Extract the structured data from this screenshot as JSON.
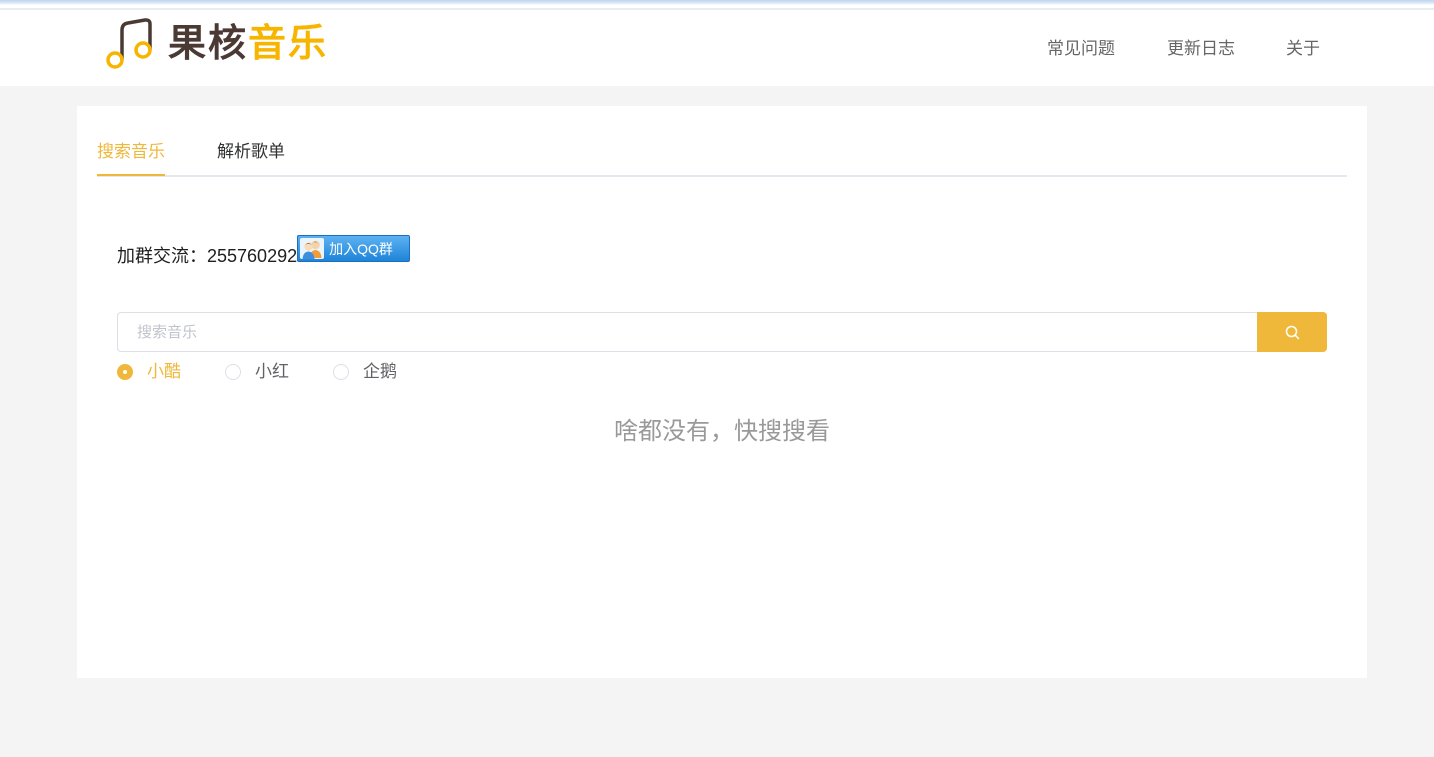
{
  "header": {
    "logo": {
      "text_primary": "果核",
      "text_accent": "音乐",
      "icon": "music-note-icon"
    },
    "nav": [
      {
        "label": "常见问题"
      },
      {
        "label": "更新日志"
      },
      {
        "label": "关于"
      }
    ]
  },
  "tabs": [
    {
      "label": "搜索音乐",
      "active": true
    },
    {
      "label": "解析歌单",
      "active": false
    }
  ],
  "group": {
    "label": "加群交流：",
    "number": "255760292",
    "join_button": {
      "label": "加入QQ群",
      "icon": "qq-group-icon"
    }
  },
  "search": {
    "placeholder": "搜索音乐",
    "value": "",
    "button_icon": "search-icon"
  },
  "sources": [
    {
      "label": "小酷",
      "checked": true
    },
    {
      "label": "小红",
      "checked": false
    },
    {
      "label": "企鹅",
      "checked": false
    }
  ],
  "empty_message": "啥都没有，快搜搜看",
  "colors": {
    "accent": "#f0b83a",
    "logo_dark": "#4b3a34",
    "logo_accent": "#f8b500",
    "qq_button": "#2a8de0"
  }
}
